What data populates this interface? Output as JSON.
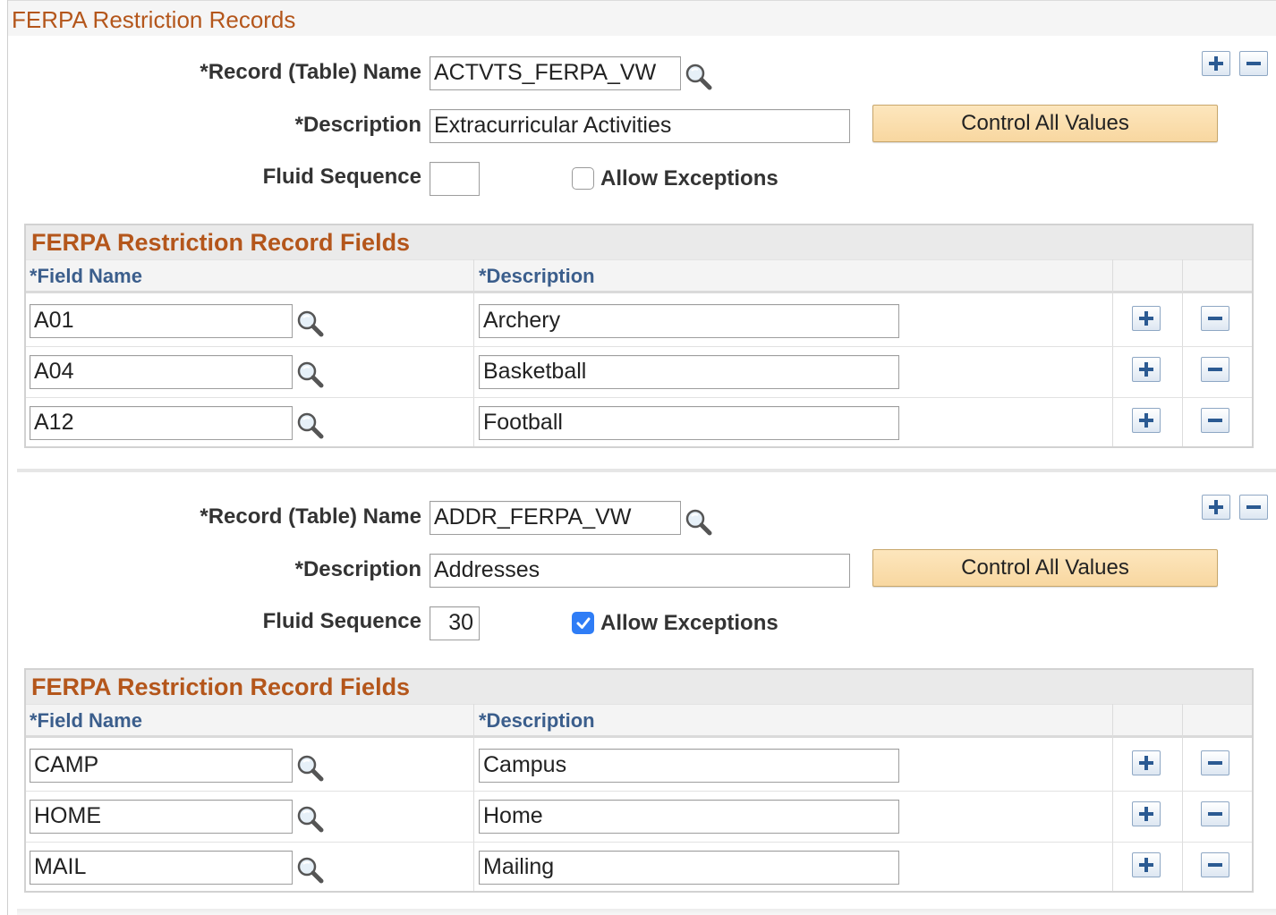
{
  "page": {
    "title": "FERPA Restriction Records"
  },
  "records": [
    {
      "record_label": "*Record (Table) Name",
      "record_value": "ACTVTS_FERPA_VW",
      "description_label": "*Description",
      "description_value": "Extracurricular Activities",
      "control_button": "Control All Values",
      "fluid_label": "Fluid Sequence",
      "fluid_value": "",
      "allow_label": "Allow Exceptions",
      "allow_checked": false,
      "grid": {
        "title": "FERPA Restriction Record Fields",
        "col_field": "*Field Name",
        "col_desc": "*Description",
        "rows": [
          {
            "field": "A01",
            "description": "Archery"
          },
          {
            "field": "A04",
            "description": "Basketball"
          },
          {
            "field": "A12",
            "description": "Football"
          }
        ]
      }
    },
    {
      "record_label": "*Record (Table) Name",
      "record_value": "ADDR_FERPA_VW",
      "description_label": "*Description",
      "description_value": "Addresses",
      "control_button": "Control All Values",
      "fluid_label": "Fluid Sequence",
      "fluid_value": "30",
      "allow_label": "Allow Exceptions",
      "allow_checked": true,
      "grid": {
        "title": "FERPA Restriction Record Fields",
        "col_field": "*Field Name",
        "col_desc": "*Description",
        "rows": [
          {
            "field": "CAMP",
            "description": "Campus"
          },
          {
            "field": "HOME",
            "description": "Home"
          },
          {
            "field": "MAIL",
            "description": "Mailing"
          }
        ]
      }
    }
  ],
  "colors": {
    "title": "#b4561b",
    "column_header": "#3b5e8c",
    "checkbox_checked": "#2f7df6",
    "control_button": "#f8d7a0"
  }
}
